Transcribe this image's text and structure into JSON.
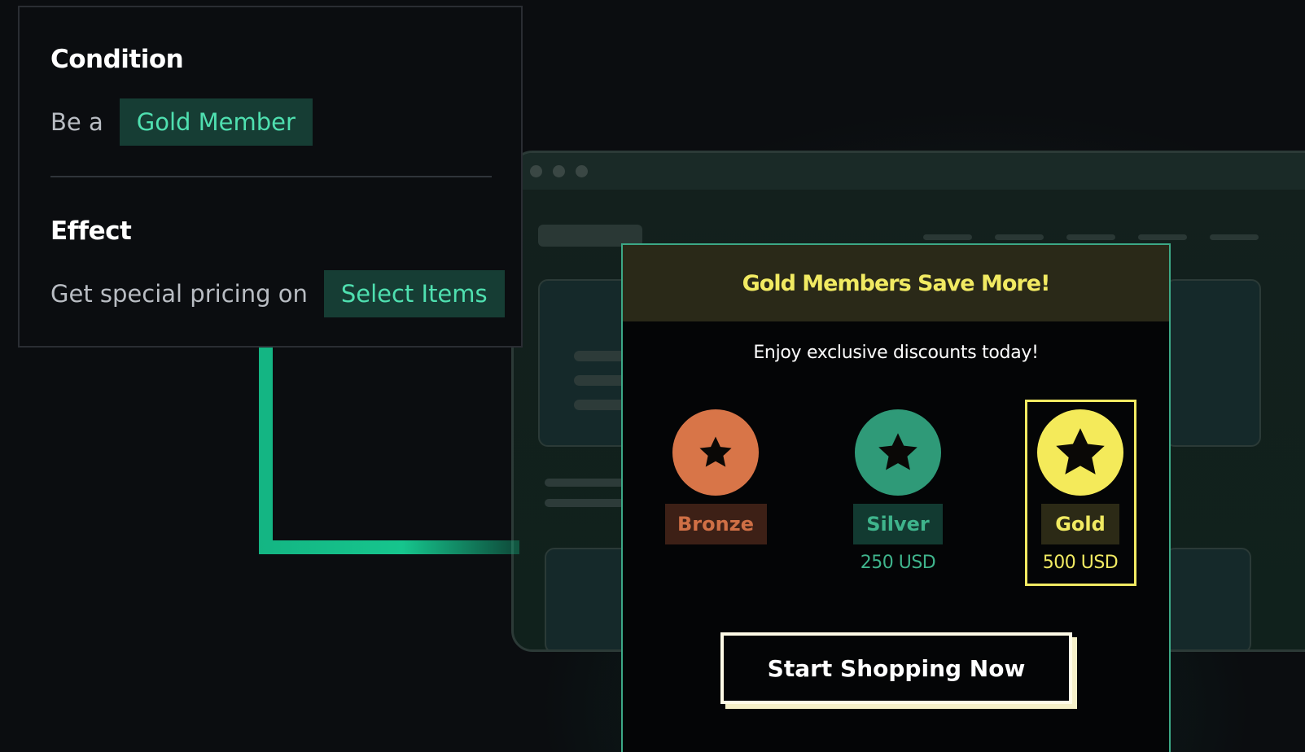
{
  "rule": {
    "condition_heading": "Condition",
    "condition_prefix": "Be a",
    "condition_value": "Gold Member",
    "effect_heading": "Effect",
    "effect_prefix": "Get special pricing on",
    "effect_value": "Select Items"
  },
  "popup": {
    "title": "Gold Members Save More!",
    "subtitle": "Enjoy exclusive discounts today!",
    "tiers": [
      {
        "label": "Bronze",
        "price": "",
        "color": "#d87548",
        "label_bg": "#3d2016",
        "label_color": "#cf6f45",
        "star_color": "#0a0806",
        "selected": false
      },
      {
        "label": "Silver",
        "price": "250 USD",
        "color": "#2f9a78",
        "label_bg": "#123a31",
        "label_color": "#3fb48c",
        "star_color": "#0a0806",
        "selected": false
      },
      {
        "label": "Gold",
        "price": "500 USD",
        "color": "#f4ea5a",
        "label_bg": "#2c2a16",
        "label_color": "#f1ea62",
        "star_color": "#0a0806",
        "selected": true
      }
    ],
    "cta_label": "Start Shopping Now"
  },
  "colors": {
    "accent_green": "#14b583",
    "chip_bg": "#163d34",
    "chip_text": "#4fe0b0",
    "popup_border": "#3ca886",
    "gold": "#f1ea62"
  },
  "icons": {
    "tier_badge": "star-icon",
    "window_controls": "window-dot-icon"
  }
}
